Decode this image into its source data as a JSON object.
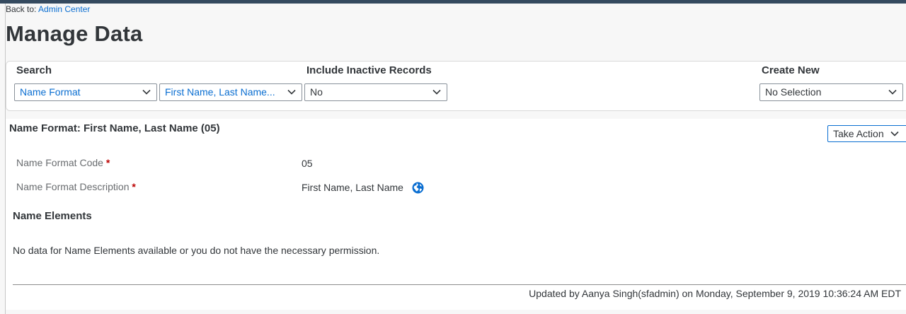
{
  "nav": {
    "back_prefix": "Back to:",
    "back_link": "Admin Center"
  },
  "page": {
    "title": "Manage Data"
  },
  "search_panel": {
    "search_label": "Search",
    "search_type_value": "Name Format",
    "search_object_value": "First Name, Last Name...",
    "include_inactive_label": "Include Inactive Records",
    "include_inactive_value": "No",
    "create_new_label": "Create New",
    "create_new_value": "No Selection"
  },
  "record": {
    "title": "Name Format: First Name, Last Name (05)",
    "take_action_label": "Take Action",
    "fields": [
      {
        "label": "Name Format Code",
        "required_mark": "*",
        "value": "05"
      },
      {
        "label": "Name Format Description",
        "required_mark": "*",
        "value": "First Name, Last Name"
      }
    ],
    "name_elements_title": "Name Elements",
    "name_elements_empty": "No data for Name Elements available or you do not have the necessary permission.",
    "updated_text": "Updated by Aanya Singh(sfadmin) on Monday, September 9, 2019 10:36:24 AM EDT"
  },
  "icons": {
    "translate": "globe-icon",
    "dropdown": "chevron-down-icon"
  },
  "colors": {
    "link": "#0a6ed1",
    "required": "#bb0000",
    "shell_bar": "#354a5f"
  }
}
